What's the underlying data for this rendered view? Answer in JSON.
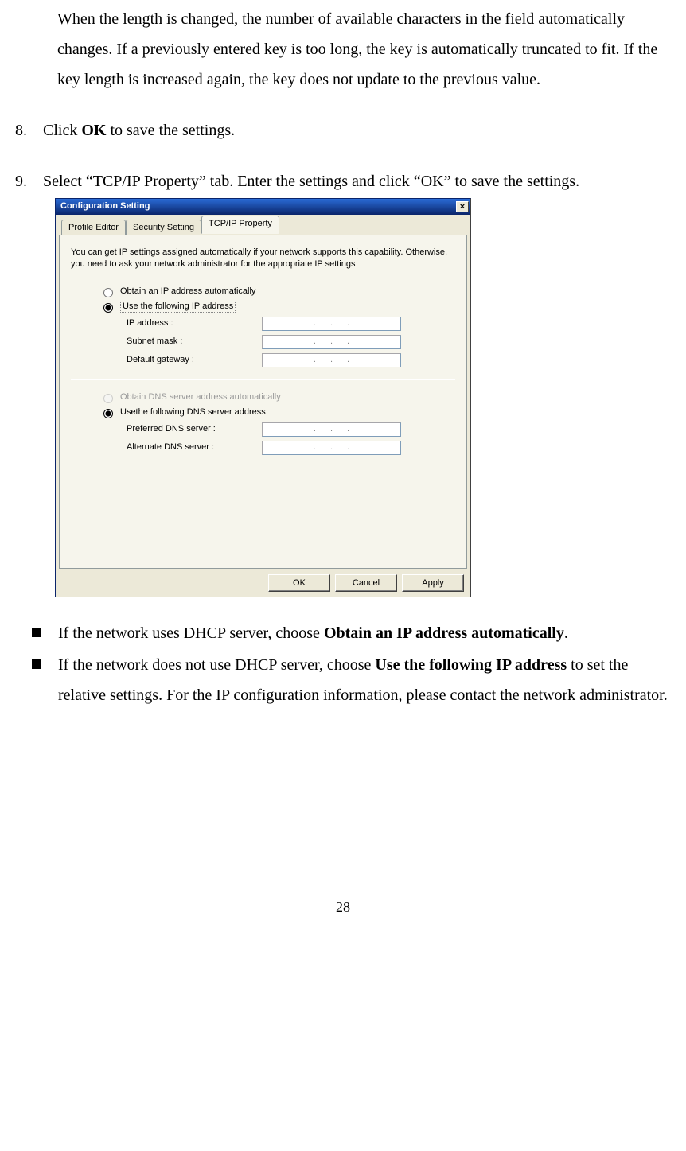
{
  "body": {
    "para_cont": "When the length is changed, the number of available characters in the field automatically changes. If a previously entered key is too long, the key is automatically truncated to fit. If the key length is increased again, the key does not update to the previous value.",
    "step8_num": "8.",
    "step8_a": "Click ",
    "step8_b": "OK",
    "step8_c": " to save the settings.",
    "step9_num": "9.",
    "step9": "Select “TCP/IP Property” tab.    Enter the settings and click “OK” to save the settings."
  },
  "dialog": {
    "title": "Configuration Setting",
    "close": "×",
    "tabs": {
      "t1": "Profile Editor",
      "t2": "Security Setting",
      "t3": "TCP/IP Property"
    },
    "intro": "You can get IP settings assigned automatically if your network supports this capability. Otherwise, you need to ask your network administrator for the appropriate IP settings",
    "r1": "Obtain an IP address automatically",
    "r2": "Use the following IP address",
    "f1": "IP address :",
    "f2": "Subnet mask :",
    "f3": "Default gateway :",
    "r3": "Obtain DNS server address automatically",
    "r4": "Usethe following DNS server address",
    "f4": "Preferred DNS server :",
    "f5": "Alternate DNS server :",
    "dots": "...",
    "ok": "OK",
    "cancel": "Cancel",
    "apply": "Apply"
  },
  "bullets": {
    "b1_a": "If the network uses DHCP server, choose ",
    "b1_b": "Obtain an IP address automatically",
    "b1_c": ".",
    "b2_a": "If the network does not use DHCP server, choose ",
    "b2_b": "Use the following IP address",
    "b2_c": " to set the relative settings.    For the IP configuration information, please contact the network administrator."
  },
  "pagenum": "28"
}
